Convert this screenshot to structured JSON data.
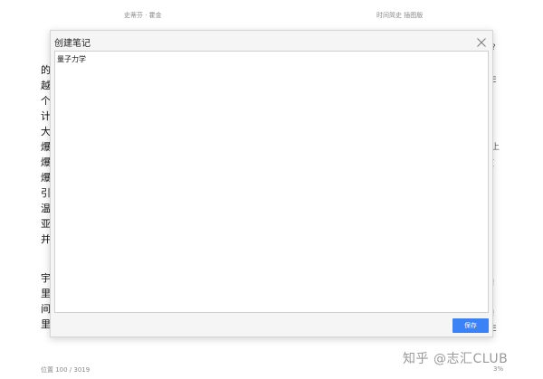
{
  "reader": {
    "author": "史蒂芬 · 霍金",
    "book_title": "时间简史 插图版",
    "position_label": "位置 100 / 3019",
    "progress_percent": "3%",
    "left_column_chars": [
      "的",
      "越",
      "个",
      "计",
      "大",
      "爆",
      "爆",
      "爆",
      "引",
      "温",
      "亚",
      "并",
      "宇",
      "里",
      "间",
      "里"
    ],
    "right_column_chars": [
      "?",
      "E",
      "i",
      "I",
      "上",
      "[",
      "I",
      "|",
      "I",
      "i",
      "l",
      ":",
      "!",
      "i",
      "!",
      "E"
    ]
  },
  "dialog": {
    "title": "创建笔记",
    "note_value": "量子力学",
    "note_placeholder": "",
    "save_label": "保存"
  },
  "watermark": {
    "text": "知乎 @志汇CLUB"
  }
}
